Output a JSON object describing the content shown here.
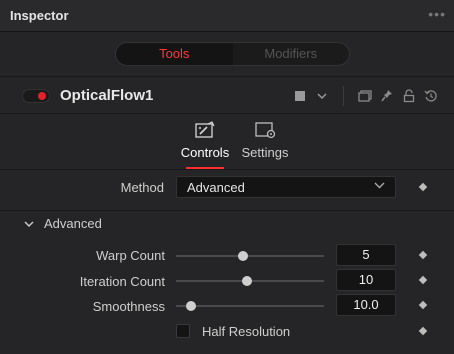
{
  "inspector": {
    "title": "Inspector",
    "more_glyph": "•••"
  },
  "mode_tabs": {
    "tools": "Tools",
    "modifiers": "Modifiers",
    "active": "Tools",
    "accent": "#ff3a3a"
  },
  "tool": {
    "name": "OpticalFlow1",
    "enabled": true,
    "enable_color": "#e0232a"
  },
  "panel_tabs": {
    "controls": "Controls",
    "settings": "Settings",
    "active": "Controls"
  },
  "method": {
    "label": "Method",
    "value": "Advanced"
  },
  "section": {
    "name": "Advanced",
    "expanded": true
  },
  "params": [
    {
      "label": "Warp Count",
      "value": "5",
      "slider": 0.45
    },
    {
      "label": "Iteration Count",
      "value": "10",
      "slider": 0.48
    },
    {
      "label": "Smoothness",
      "value": "10.0",
      "slider": 0.1
    }
  ],
  "half_resolution": {
    "label": "Half Resolution",
    "checked": false
  }
}
